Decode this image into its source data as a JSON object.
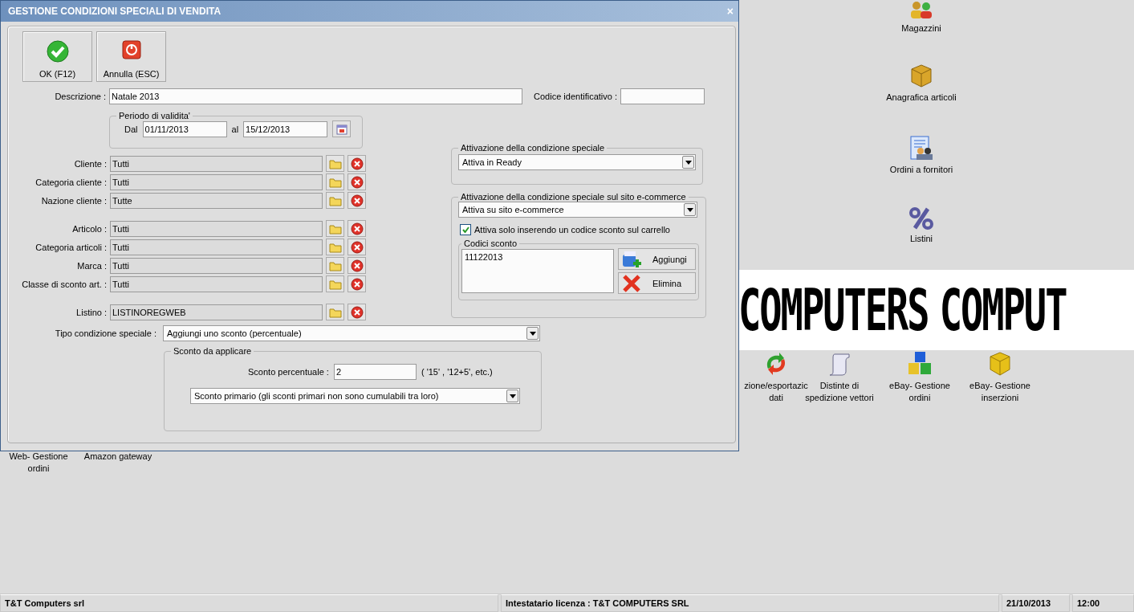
{
  "window": {
    "title": "GESTIONE CONDIZIONI SPECIALI DI VENDITA",
    "close": "×"
  },
  "toolbar": [
    {
      "label": "OK (F12)",
      "kind": "ok"
    },
    {
      "label": "Annulla (ESC)",
      "kind": "cancel"
    }
  ],
  "descrizione": {
    "label": "Descrizione :",
    "value": "Natale 2013"
  },
  "codice": {
    "label": "Codice identificativo :"
  },
  "periodo": {
    "title": "Periodo di validita'",
    "from_label": "Dal",
    "from": "01/11/2013",
    "to_label": "al",
    "to": "15/12/2013"
  },
  "filter_groups": [
    {
      "items": [
        {
          "label": "Cliente :",
          "value": "Tutti"
        },
        {
          "label": "Categoria cliente :",
          "value": "Tutti"
        },
        {
          "label": "Nazione cliente :",
          "value": "Tutte"
        }
      ]
    },
    {
      "items": [
        {
          "label": "Articolo :",
          "value": "Tutti"
        },
        {
          "label": "Categoria articoli :",
          "value": "Tutti"
        },
        {
          "label": "Marca :",
          "value": "Tutti"
        },
        {
          "label": "Classe di sconto art. :",
          "value": "Tutti"
        }
      ]
    },
    {
      "items": [
        {
          "label": "Listino :",
          "value": "LISTINOREGWEB"
        }
      ]
    }
  ],
  "activation": {
    "title": "Attivazione della condizione speciale",
    "value": "Attiva in Ready"
  },
  "ecommerce": {
    "title": "Attivazione della condizione speciale sul sito e-commerce",
    "value": "Attiva su sito e-commerce",
    "checkbox": {
      "label": "Attiva solo inserendo un codice sconto sul carrello",
      "checked": true
    },
    "codes": {
      "title": "Codici sconto",
      "items": [
        "11122013"
      ],
      "buttons": [
        {
          "label": "Aggiungi",
          "kind": "add"
        },
        {
          "label": "Elimina",
          "kind": "delete"
        }
      ]
    }
  },
  "tipo": {
    "label": "Tipo condizione speciale :",
    "value": "Aggiungi uno sconto (percentuale)"
  },
  "sconto": {
    "title": "Sconto da applicare",
    "label": "Sconto percentuale :",
    "value": "2",
    "hint": "( '15' ,  '12+5', etc.)",
    "mode": "Sconto primario (gli sconti primari non sono cumulabili tra loro)"
  },
  "desktop_icons": [
    {
      "label": "Magazzini",
      "kind": "people"
    },
    {
      "label": "Anagrafica articoli",
      "kind": "box"
    },
    {
      "label": "Ordini a fornitori",
      "kind": "orders"
    },
    {
      "label": "Listini",
      "kind": "percent"
    },
    {
      "label": "zione/esportazic\ndati",
      "kind": "arrows"
    },
    {
      "label": "Distinte di\nspedizione vettori",
      "kind": "scroll"
    },
    {
      "label": "eBay- Gestione\nordini",
      "kind": "cubes"
    },
    {
      "label": "eBay- Gestione\ninserzioni",
      "kind": "cube"
    },
    {
      "label": "Web- Gestione\nordini",
      "kind": "none"
    },
    {
      "label": "Amazon gateway",
      "kind": "none"
    }
  ],
  "banner": [
    "COMPUTERS",
    "COMPUT"
  ],
  "status_bar": [
    "T&T Computers srl",
    "Intestatario licenza : T&T COMPUTERS SRL",
    "21/10/2013",
    "12:00"
  ]
}
